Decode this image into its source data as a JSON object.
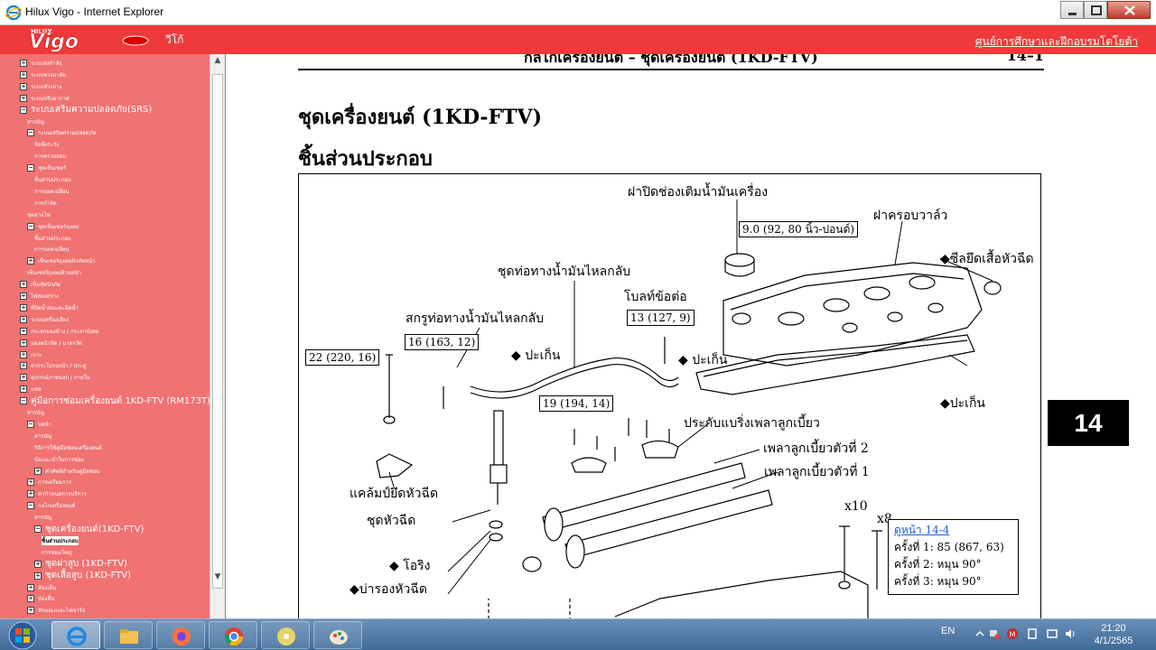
{
  "window": {
    "title": "Hilux Vigo - Internet Explorer"
  },
  "header": {
    "logo_text": "Vigo",
    "logo_small": "HILUX",
    "subtitle": "วีโก้",
    "right_link": "ศูนย์การศึกษาและฝึกอบรมโตโยต้า"
  },
  "sidebar": {
    "items": [
      {
        "label": "ระบบส่งกำลัง",
        "pm": "+",
        "indent": 0,
        "size": "s"
      },
      {
        "label": "ระบบพวงมาลัย",
        "pm": "+",
        "indent": 0,
        "size": "s"
      },
      {
        "label": "ระบบช่วงล่าง",
        "pm": "+",
        "indent": 0,
        "size": "s"
      },
      {
        "label": "ระบบปรับอากาศ",
        "pm": "+",
        "indent": 0,
        "size": "s"
      },
      {
        "label": "ระบบเสริมความปลอดภัย(SRS)",
        "pm": "−",
        "indent": 0,
        "size": "m"
      },
      {
        "label": "สารบัญ",
        "pm": "",
        "indent": 2,
        "size": "s"
      },
      {
        "label": "ระบบเสริมความปลอดภัย",
        "pm": "−",
        "indent": 2,
        "size": "s"
      },
      {
        "label": "ข้อพึงระวัง",
        "pm": "",
        "indent": 4,
        "size": "s"
      },
      {
        "label": "การตรวจสอบ",
        "pm": "",
        "indent": 4,
        "size": "s"
      },
      {
        "label": "ชุดเซ็นเซอร์",
        "pm": "−",
        "indent": 2,
        "size": "s"
      },
      {
        "label": "ชิ้นส่วนประกอบ",
        "pm": "",
        "indent": 4,
        "size": "s"
      },
      {
        "label": "การถอดเปลี่ยน",
        "pm": "",
        "indent": 4,
        "size": "s"
      },
      {
        "label": "การกำจัด",
        "pm": "",
        "indent": 4,
        "size": "s"
      },
      {
        "label": "ชุดสายไฟ",
        "pm": "",
        "indent": 2,
        "size": "s"
      },
      {
        "label": "ชุดเซ็นเซอร์ถุงลม",
        "pm": "−",
        "indent": 2,
        "size": "s"
      },
      {
        "label": "ชิ้นส่วนประกอบ",
        "pm": "",
        "indent": 4,
        "size": "s"
      },
      {
        "label": "การถอดเปลี่ยน",
        "pm": "",
        "indent": 4,
        "size": "s"
      },
      {
        "label": "เซ็นเซอร์ถุงลมนิรภัยหน้า",
        "pm": "+",
        "indent": 2,
        "size": "s"
      },
      {
        "label": "เซ็นเซอร์ถุงลมด้านหน้า",
        "pm": "",
        "indent": 2,
        "size": "s"
      },
      {
        "label": "เข็มขัดนิรภัย",
        "pm": "+",
        "indent": 0,
        "size": "s"
      },
      {
        "label": "ไฟส่องสว่าง",
        "pm": "+",
        "indent": 0,
        "size": "s"
      },
      {
        "label": "ที่ปัดน้ำฝนและฉีดน้ำ",
        "pm": "+",
        "indent": 0,
        "size": "s"
      },
      {
        "label": "ระบบเครื่องเสียง",
        "pm": "+",
        "indent": 0,
        "size": "s"
      },
      {
        "label": "กระจกมองข้าง / กระจกบังลม",
        "pm": "+",
        "indent": 0,
        "size": "s"
      },
      {
        "label": "แผงหน้าปัด / มาตรวัด",
        "pm": "+",
        "indent": 0,
        "size": "s"
      },
      {
        "label": "เบาะ",
        "pm": "+",
        "indent": 0,
        "size": "s"
      },
      {
        "label": "ฝากระโปรงหน้า / ประตู",
        "pm": "+",
        "indent": 0,
        "size": "s"
      },
      {
        "label": "อุปกรณ์ภายนอก / ภายใน",
        "pm": "+",
        "indent": 0,
        "size": "s"
      },
      {
        "label": "แชส",
        "pm": "+",
        "indent": 0,
        "size": "s"
      },
      {
        "label": "คู่มือการซ่อมเครื่องยนต์ 1KD-FTV (RM173T)",
        "pm": "−",
        "indent": 0,
        "size": "m"
      },
      {
        "label": "สารบัญ",
        "pm": "",
        "indent": 2,
        "size": "s"
      },
      {
        "label": "บทนำ",
        "pm": "−",
        "indent": 2,
        "size": "s"
      },
      {
        "label": "สารบัญ",
        "pm": "",
        "indent": 4,
        "size": "s"
      },
      {
        "label": "วิธีการใช้คู่มือซ่อมเครื่องยนต์",
        "pm": "",
        "indent": 4,
        "size": "s"
      },
      {
        "label": "ข้อแนะนำในการซ่อม",
        "pm": "",
        "indent": 4,
        "size": "s"
      },
      {
        "label": "คำศัพท์สำหรับคู่มือซ่อม",
        "pm": "+",
        "indent": 4,
        "size": "s"
      },
      {
        "label": "การเตรียมการ",
        "pm": "+",
        "indent": 2,
        "size": "s"
      },
      {
        "label": "ค่ากำหนดการบริการ",
        "pm": "+",
        "indent": 2,
        "size": "s"
      },
      {
        "label": "กลไกเครื่องยนต์",
        "pm": "−",
        "indent": 2,
        "size": "s"
      },
      {
        "label": "สารบัญ",
        "pm": "",
        "indent": 4,
        "size": "s"
      },
      {
        "label": "ชุดเครื่องยนต์(1KD-FTV)",
        "pm": "−",
        "indent": 4,
        "size": "m"
      },
      {
        "label": "ชิ้นส่วนประกอบ",
        "pm": "",
        "indent": 6,
        "size": "s",
        "selected": true
      },
      {
        "label": "การซ่อมใหญ่",
        "pm": "",
        "indent": 6,
        "size": "s"
      },
      {
        "label": "ชุดฝาสูบ (1KD-FTV)",
        "pm": "+",
        "indent": 4,
        "size": "m"
      },
      {
        "label": "ชุดเสื้อสูบ (1KD-FTV)",
        "pm": "+",
        "indent": 4,
        "size": "m"
      },
      {
        "label": "ห้องเย็น",
        "pm": "+",
        "indent": 2,
        "size": "s"
      },
      {
        "label": "ห้องอื่น",
        "pm": "+",
        "indent": 2,
        "size": "s"
      },
      {
        "label": "ลักษณะและไฟชาร์จ",
        "pm": "+",
        "indent": 2,
        "size": "s"
      }
    ]
  },
  "document": {
    "section_header": "กลไกเครื่องยนต์ – ชุดเครื่องยนต์ (1KD-FTV)",
    "page_number": "14–1",
    "title": "ชุดเครื่องยนต์ (1KD-FTV)",
    "subtitle": "ชิ้นส่วนประกอบ",
    "page_tab": "14",
    "labels": {
      "oil_filler_cap": "ฝาปิดช่องเติมน้ำมันเครื่อง",
      "valve_cover": "ฝาครอบวาล์ว",
      "injector_seal": "◆ซีลยึดเสื้อหัวฉีด",
      "leak_pipe_set": "ชุดท่อทางน้ำมันไหลกลับ",
      "union_bolt": "โบลท์ข้อต่อ",
      "leak_pipe_screw": "สกรูท่อทางน้ำมันไหลกลับ",
      "gasket_1": "◆ ปะเก็น",
      "gasket_2": "◆ ปะเก็น",
      "gasket_3": "◆ปะเก็น",
      "bearing_cap": "ประกับแบริ่งเพลาลูกเบี้ยว",
      "camshaft_2": "เพลาลูกเบี้ยวตัวที่ 2",
      "camshaft_1": "เพลาลูกเบี้ยวตัวที่ 1",
      "injector_clamp": "แคล้มป์ยึดหัวฉีด",
      "injector_set": "ชุดหัวฉีด",
      "o_ring": "◆ โอริง",
      "injector_washer": "◆บ่ารองหัวฉีด",
      "x10": "x10",
      "x8": "x8"
    },
    "torques": {
      "t1": "9.0 (92, 80 นิ้ว-ปอนด์)",
      "t2": "13 (127, 9)",
      "t3": "16 (163, 12)",
      "t4": "22 (220, 16)",
      "t5": "19 (194, 14)"
    },
    "note": {
      "ref": "ดูหน้า 14-4",
      "line1": "ครั้งที่ 1: 85 (867, 63)",
      "line2": "ครั้งที่ 2: หมุน 90°",
      "line3": "ครั้งที่ 3: หมุน 90°"
    }
  },
  "taskbar": {
    "apps": [
      "internet-explorer",
      "file-explorer",
      "firefox",
      "chrome",
      "media-player",
      "paint"
    ],
    "lang": "EN",
    "time": "21:20",
    "date": "4/1/2565"
  }
}
